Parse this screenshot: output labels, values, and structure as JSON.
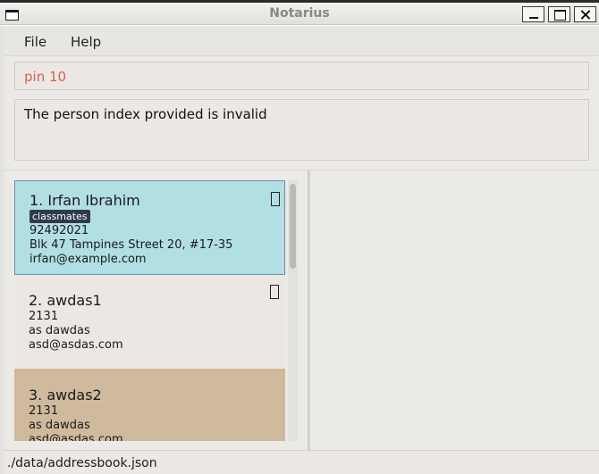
{
  "window": {
    "title": "Notarius"
  },
  "menu": {
    "items": [
      "File",
      "Help"
    ]
  },
  "command_box": {
    "value": "pin 10"
  },
  "result_display": {
    "text": "The person index provided is invalid"
  },
  "persons": [
    {
      "name": "1. Irfan Ibrahim",
      "tags": [
        "classmates"
      ],
      "phone": "92492021",
      "address": "Blk 47 Tampines Street 20, #17-35",
      "email": "irfan@example.com",
      "pinned_icon": true
    },
    {
      "name": "2. awdas1",
      "tags": [],
      "phone": "2131",
      "address": "as dawdas",
      "email": "asd@asdas.com",
      "pinned_icon": true
    },
    {
      "name": "3. awdas2",
      "tags": [],
      "phone": "2131",
      "address": "as dawdas",
      "email": "asd@asdas.com",
      "pinned_icon": false
    }
  ],
  "status_bar": {
    "path": "./data/addressbook.json"
  },
  "colors": {
    "selected_card": "#b1dfe4",
    "card": "#ede7e4",
    "card_alt": "#cfba9d",
    "command_text": "#d2634a",
    "tag_bg": "#2e3b4c"
  }
}
